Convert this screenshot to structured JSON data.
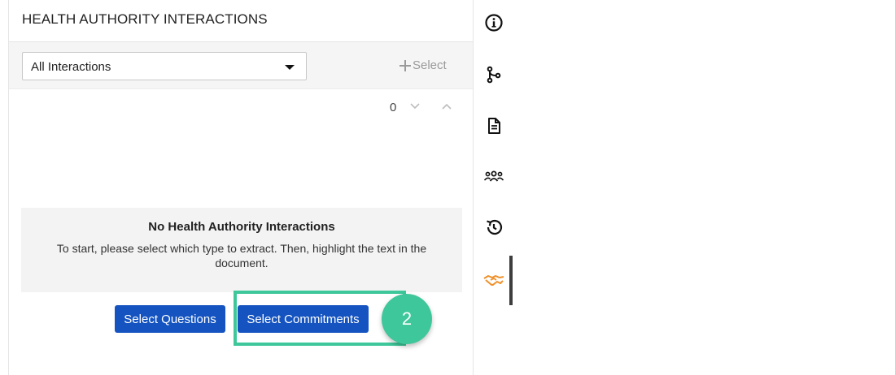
{
  "panel": {
    "title": "HEALTH AUTHORITY INTERACTIONS"
  },
  "filter": {
    "selected_option": "All Interactions",
    "add_select_label": "Select"
  },
  "navigation": {
    "count": "0"
  },
  "empty_state": {
    "title": "No Health Authority Interactions",
    "message": "To start, please select which type to extract. Then, highlight the text in the document."
  },
  "actions": {
    "select_questions_label": "Select Questions",
    "select_commitments_label": "Select Commitments"
  },
  "annotation": {
    "step_number": "2",
    "highlight_color": "#3ec79a"
  },
  "rail": {
    "icons": [
      "info-icon",
      "branch-icon",
      "document-icon",
      "people-icon",
      "history-icon",
      "handshake-icon"
    ],
    "active_icon": "handshake-icon",
    "active_color": "#f0902a"
  },
  "colors": {
    "primary_button": "#1554c0",
    "muted_text": "#9a9a9a"
  }
}
